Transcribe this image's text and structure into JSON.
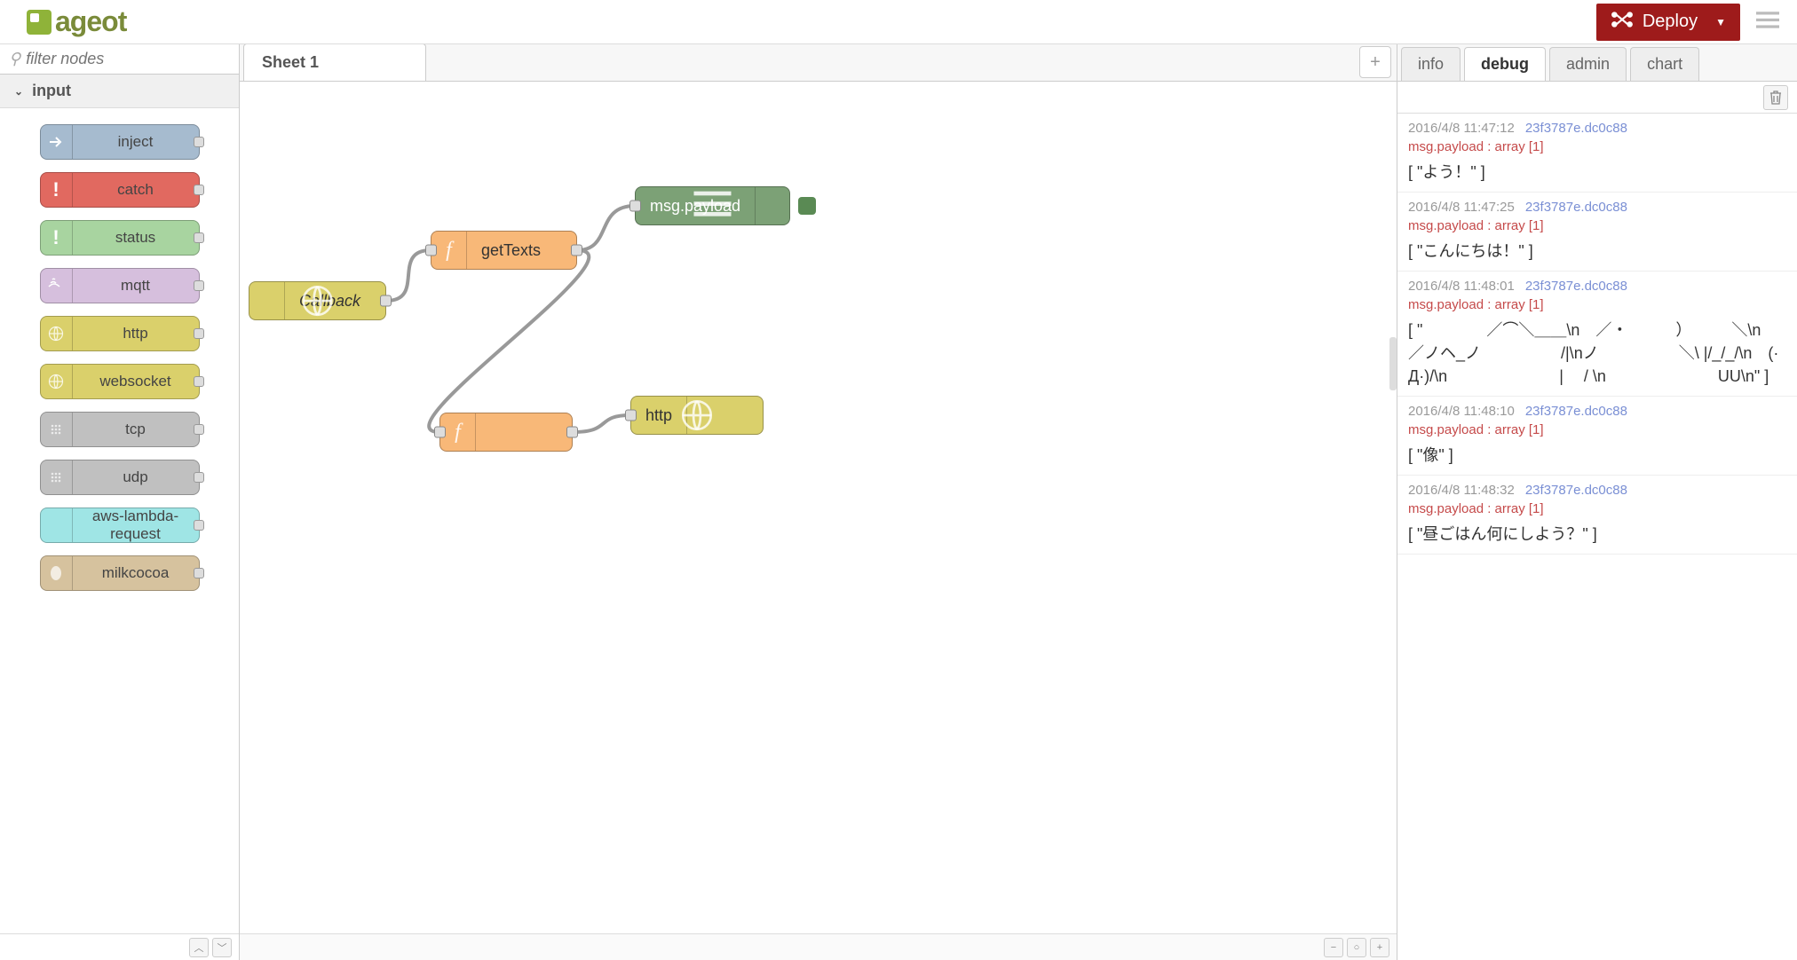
{
  "header": {
    "logo_text": "ageot",
    "deploy_label": "Deploy"
  },
  "palette": {
    "filter_placeholder": "filter nodes",
    "category": "input",
    "nodes": [
      {
        "label": "inject",
        "class": "pnode-blue",
        "icon": "arrow"
      },
      {
        "label": "catch",
        "class": "pnode-red",
        "icon": "bang"
      },
      {
        "label": "status",
        "class": "pnode-green",
        "icon": "bang"
      },
      {
        "label": "mqtt",
        "class": "pnode-purple",
        "icon": "wave"
      },
      {
        "label": "http",
        "class": "pnode-yellow",
        "icon": "globe"
      },
      {
        "label": "websocket",
        "class": "pnode-yellow",
        "icon": "globe"
      },
      {
        "label": "tcp",
        "class": "pnode-gray",
        "icon": "dots"
      },
      {
        "label": "udp",
        "class": "pnode-gray",
        "icon": "dots"
      },
      {
        "label": "aws-lambda-request",
        "class": "pnode-cyan",
        "icon": ""
      },
      {
        "label": "milkcocoa",
        "class": "pnode-tan",
        "icon": "bean"
      }
    ]
  },
  "workspace": {
    "tab_label": "Sheet 1",
    "nodes": {
      "callback": "Callback",
      "getTexts": "getTexts",
      "msgpayload": "msg.payload",
      "func2": "",
      "http": "http"
    }
  },
  "sidebar": {
    "tabs": {
      "info": "info",
      "debug": "debug",
      "admin": "admin",
      "chart": "chart"
    },
    "messages": [
      {
        "time": "2016/4/8 11:47:12",
        "node": "23f3787e.dc0c88",
        "topic": "msg.payload : array [1]",
        "payload": "[ \"よう！\" ]"
      },
      {
        "time": "2016/4/8 11:47:25",
        "node": "23f3787e.dc0c88",
        "topic": "msg.payload : array [1]",
        "payload": "[ \"こんにちは！\" ]"
      },
      {
        "time": "2016/4/8 11:48:01",
        "node": "23f3787e.dc0c88",
        "topic": "msg.payload : array [1]",
        "payload": "[ \"　　　　／⌒＼＿＿\\n　／・　　　）　　　＼\\n　／ノヘ_ノ　　　　　/|\\nノ　　　　　＼\\ |/_/_/\\n　(·Д·)/\\n　　　　　　　|　 / \\n　　　　　　　UU\\n\" ]"
      },
      {
        "time": "2016/4/8 11:48:10",
        "node": "23f3787e.dc0c88",
        "topic": "msg.payload : array [1]",
        "payload": "[ \"像\" ]"
      },
      {
        "time": "2016/4/8 11:48:32",
        "node": "23f3787e.dc0c88",
        "topic": "msg.payload : array [1]",
        "payload": "[ \"昼ごはん何にしよう？\" ]"
      }
    ]
  }
}
